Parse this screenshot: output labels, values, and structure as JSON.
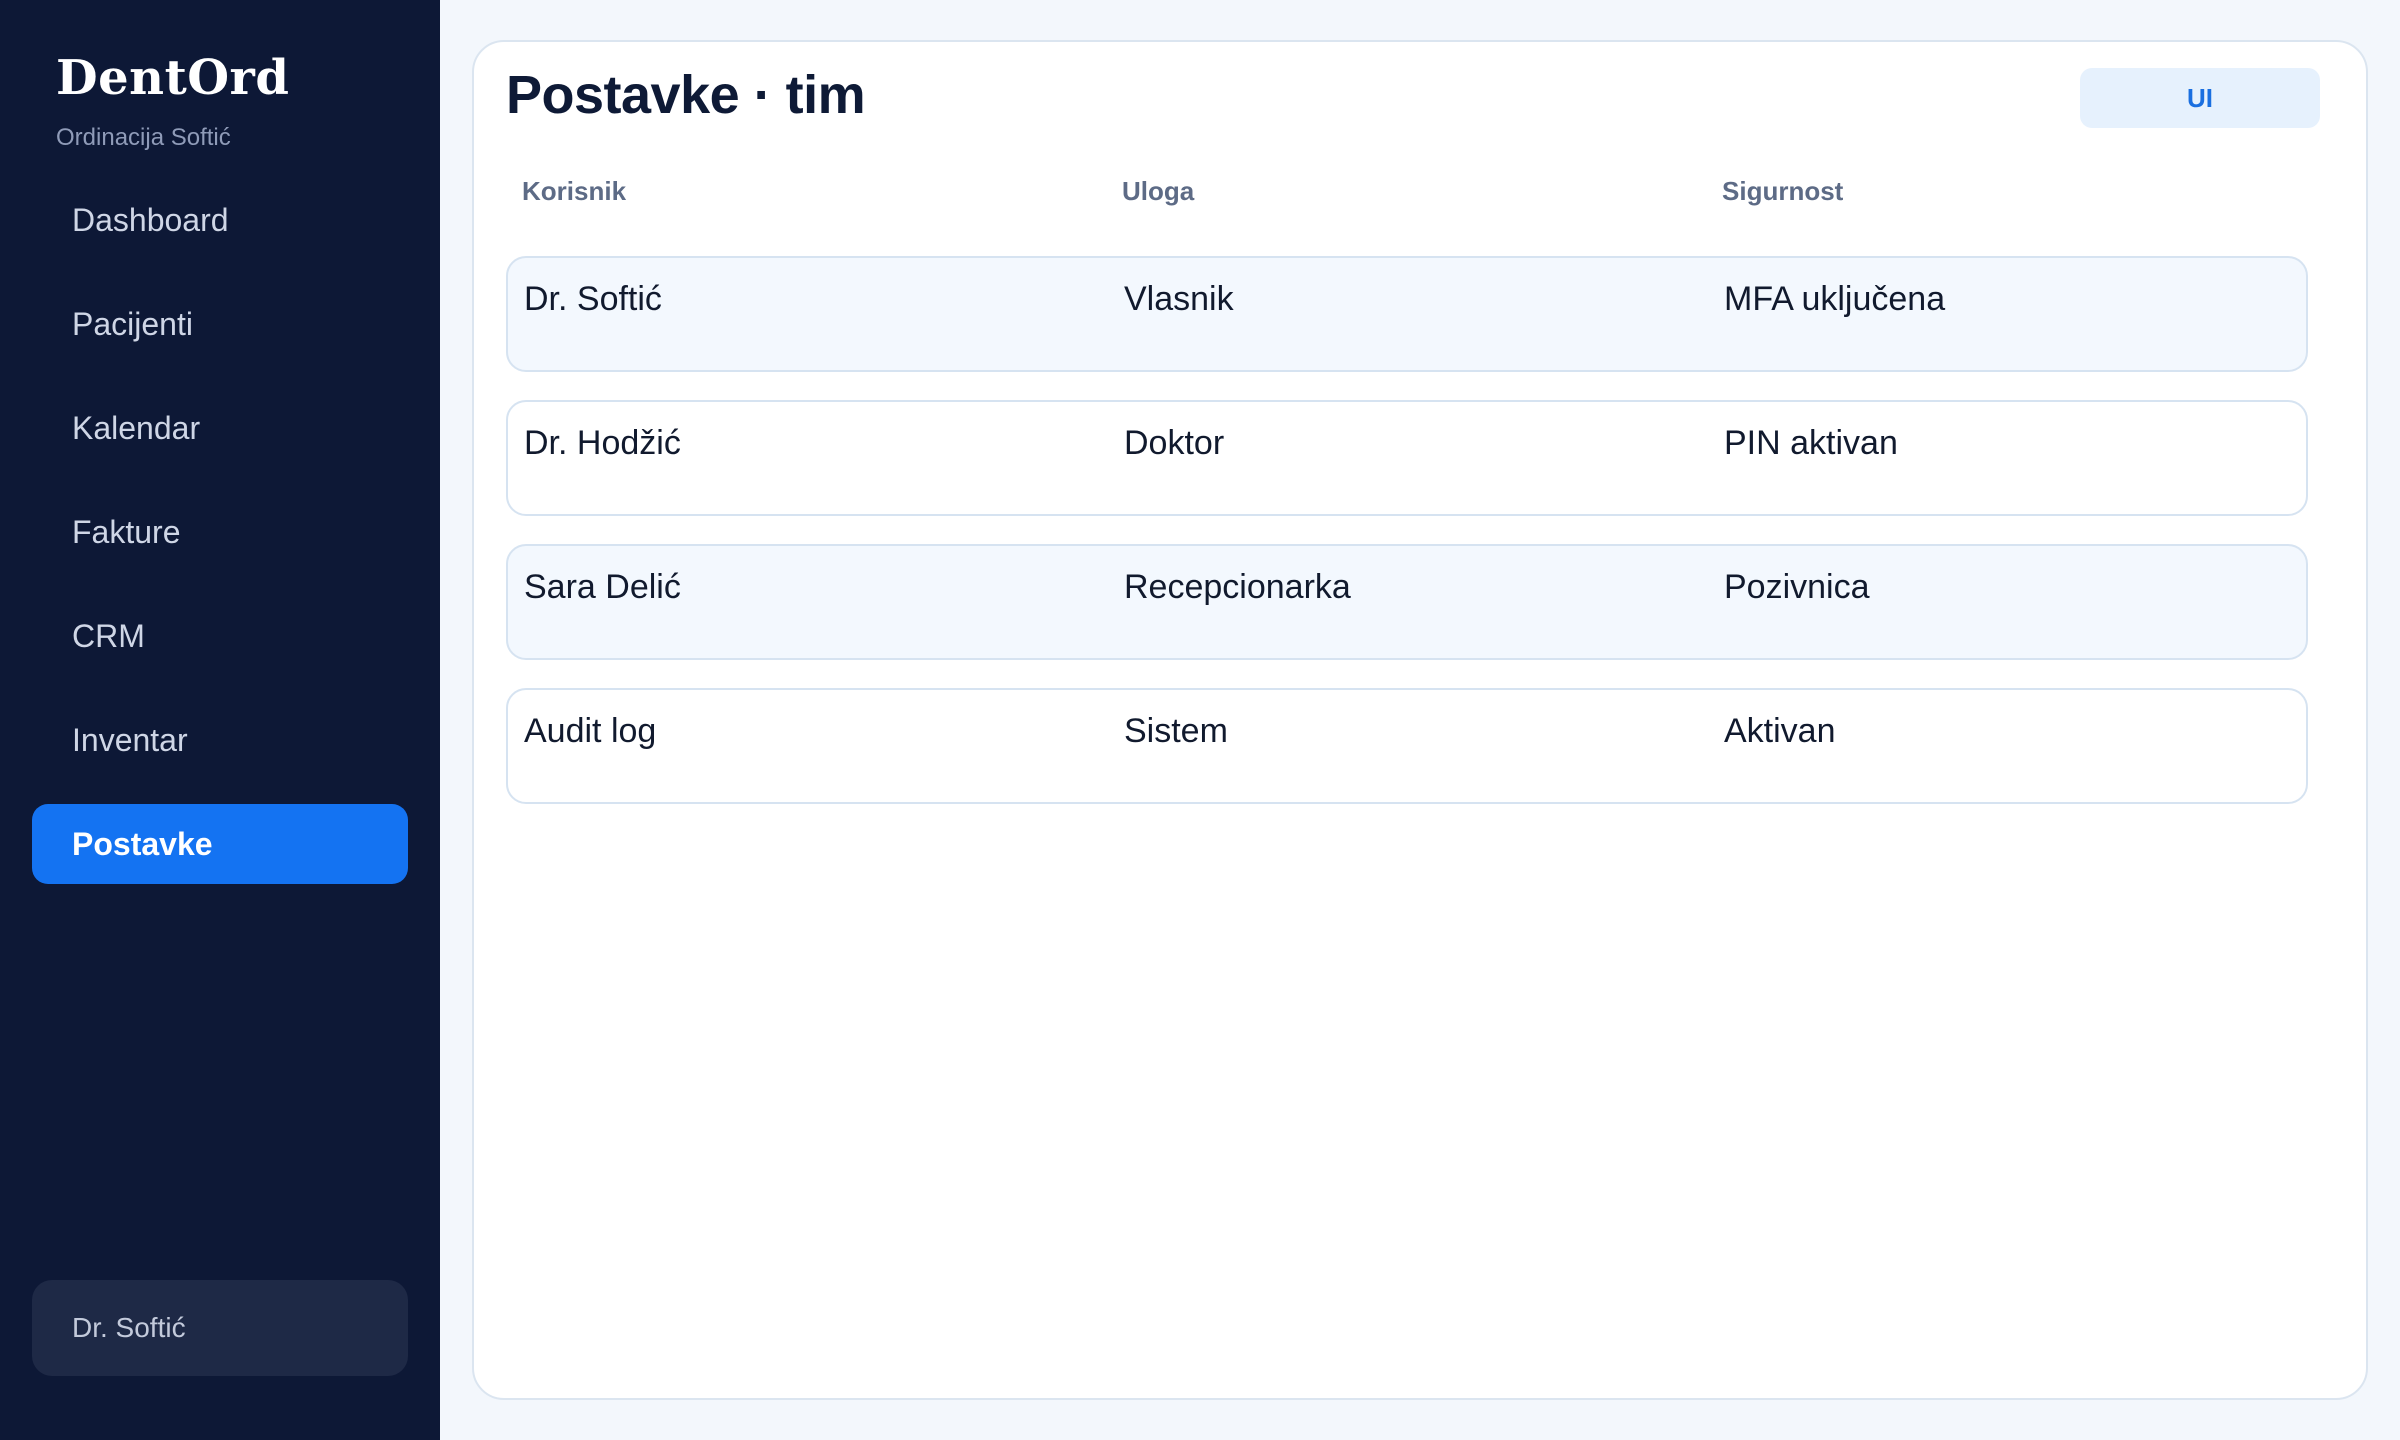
{
  "app": {
    "brand": "DentOrd",
    "clinic": "Ordinacija Softić"
  },
  "sidebar": {
    "items": [
      {
        "label": "Dashboard",
        "active": false
      },
      {
        "label": "Pacijenti",
        "active": false
      },
      {
        "label": "Kalendar",
        "active": false
      },
      {
        "label": "Fakture",
        "active": false
      },
      {
        "label": "CRM",
        "active": false
      },
      {
        "label": "Inventar",
        "active": false
      },
      {
        "label": "Postavke",
        "active": true
      }
    ],
    "user": "Dr. Softić"
  },
  "main": {
    "title": "Postavke · tim",
    "ui_button_label": "UI",
    "columns": [
      "Korisnik",
      "Uloga",
      "Sigurnost"
    ],
    "rows": [
      {
        "user": "Dr. Softić",
        "role": "Vlasnik",
        "security": "MFA uključena"
      },
      {
        "user": "Dr. Hodžić",
        "role": "Doktor",
        "security": "PIN aktivan"
      },
      {
        "user": "Sara Delić",
        "role": "Recepcionarka",
        "security": "Pozivnica"
      },
      {
        "user": "Audit log",
        "role": "Sistem",
        "security": "Aktivan"
      }
    ]
  },
  "colors": {
    "sidebar_bg": "#0d1836",
    "accent": "#1473f2",
    "page_bg": "#f3f7fc"
  }
}
